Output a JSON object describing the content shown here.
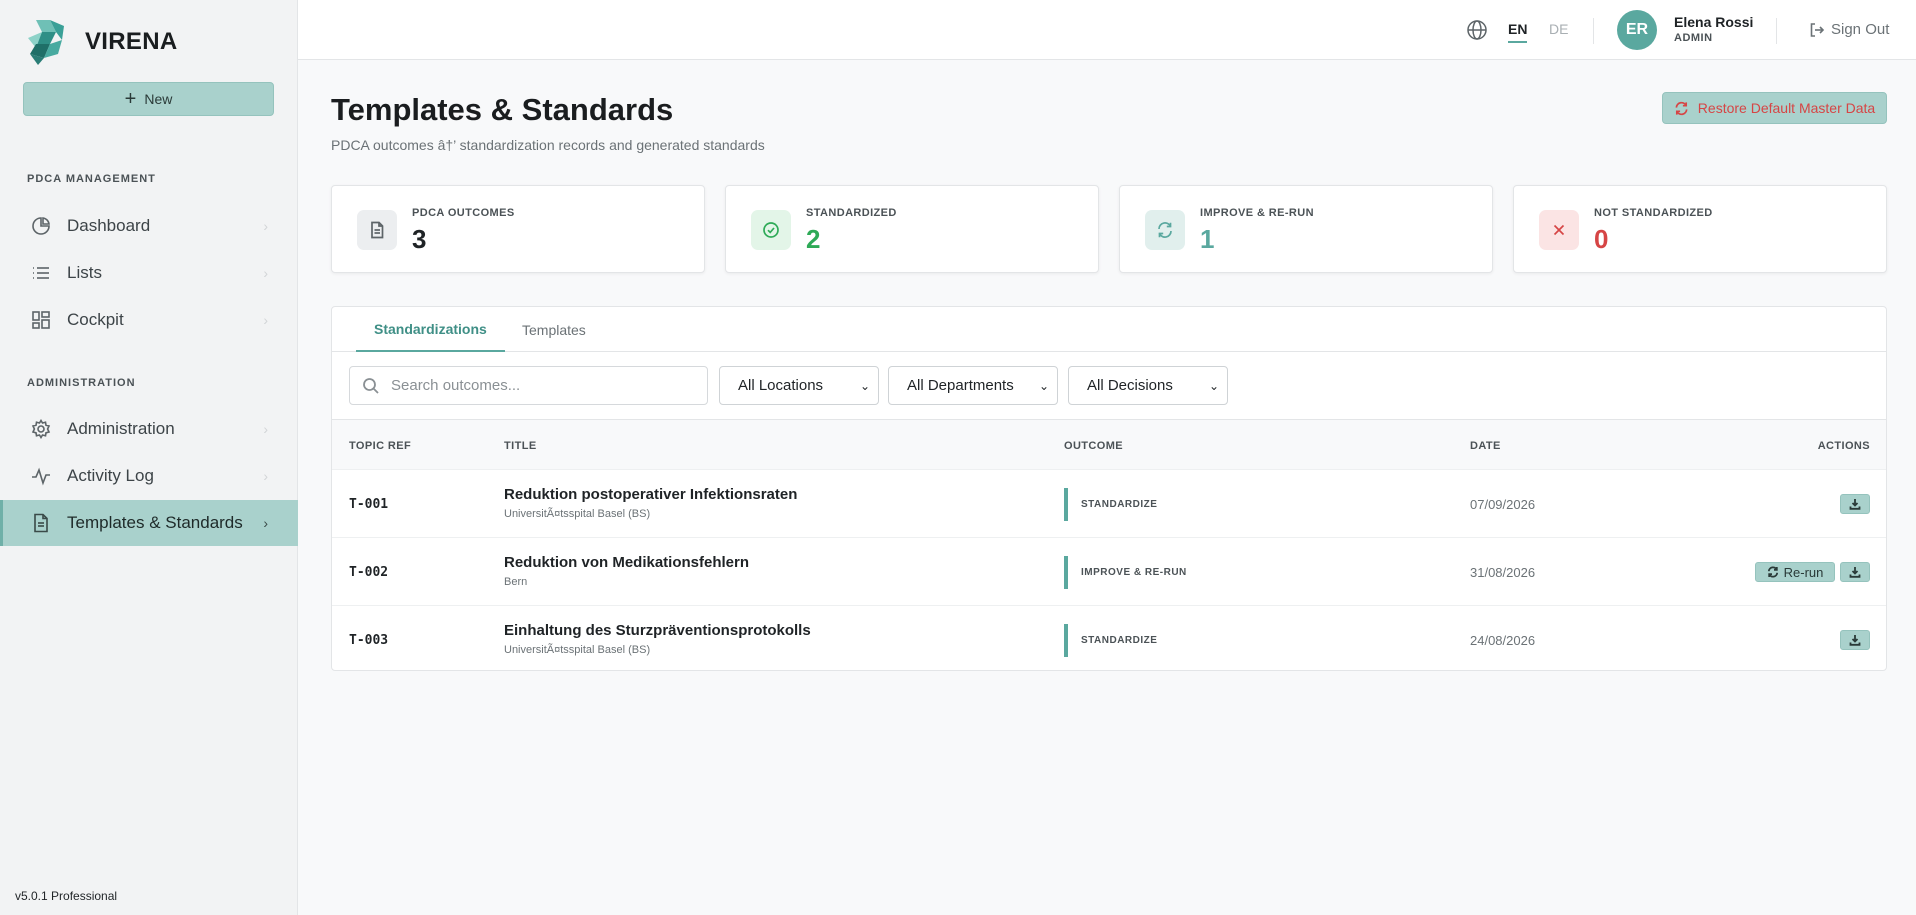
{
  "brand": {
    "name": "VIRENA"
  },
  "sidebar": {
    "new_label": "New",
    "sections": [
      {
        "label": "PDCA MANAGEMENT"
      },
      {
        "label": "ADMINISTRATION"
      }
    ],
    "items": [
      {
        "label": "Dashboard",
        "icon": "pie-chart-icon"
      },
      {
        "label": "Lists",
        "icon": "list-icon"
      },
      {
        "label": "Cockpit",
        "icon": "grid-icon"
      },
      {
        "label": "Administration",
        "icon": "gear-icon"
      },
      {
        "label": "Activity Log",
        "icon": "activity-icon"
      },
      {
        "label": "Templates & Standards",
        "icon": "document-icon",
        "active": true
      }
    ],
    "version": "v5.0.1 Professional"
  },
  "topbar": {
    "lang_en": "EN",
    "lang_de": "DE",
    "avatar_initials": "ER",
    "user_name": "Elena Rossi",
    "user_role": "ADMIN",
    "signout_label": "Sign Out"
  },
  "page": {
    "title": "Templates & Standards",
    "subtitle": "PDCA outcomes â†’ standardization records and generated standards",
    "restore_label": "Restore Default Master Data"
  },
  "stats": [
    {
      "label": "PDCA OUTCOMES",
      "value": "3",
      "color": "#1f2326"
    },
    {
      "label": "STANDARDIZED",
      "value": "2",
      "color": "#2eaa57"
    },
    {
      "label": "IMPROVE & RE-RUN",
      "value": "1",
      "color": "#5aa89f"
    },
    {
      "label": "NOT STANDARDIZED",
      "value": "0",
      "color": "#d64545"
    }
  ],
  "tabs": [
    {
      "label": "Standardizations",
      "active": true
    },
    {
      "label": "Templates",
      "active": false
    }
  ],
  "filters": {
    "search_placeholder": "Search outcomes...",
    "locations": "All Locations",
    "departments": "All Departments",
    "decisions": "All Decisions"
  },
  "table": {
    "headers": [
      "TOPIC REF",
      "TITLE",
      "OUTCOME",
      "DATE",
      "ACTIONS"
    ],
    "rows": [
      {
        "ref": "T-001",
        "title": "Reduktion postoperativer Infektionsraten",
        "location": "UniversitÃ¤tsspital Basel (BS)",
        "outcome": "STANDARDIZE",
        "date": "07/09/2026"
      },
      {
        "ref": "T-002",
        "title": "Reduktion von Medikationsfehlern",
        "location": "Bern",
        "outcome": "IMPROVE & RE-RUN",
        "date": "31/08/2026",
        "rerun_label": "Re-run"
      },
      {
        "ref": "T-003",
        "title": "Einhaltung des Sturzpräventionsprotokolls",
        "location": "UniversitÃ¤tsspital Basel (BS)",
        "outcome": "STANDARDIZE",
        "date": "24/08/2026"
      }
    ]
  },
  "colors": {
    "accent": "#5aa89f",
    "accent_light": "#a9d1cc",
    "danger": "#d64545",
    "success": "#2eaa57"
  }
}
